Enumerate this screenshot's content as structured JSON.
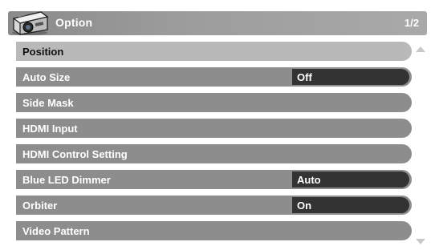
{
  "header": {
    "icon": "projector-icon",
    "title": "Option",
    "page_indicator": "1/2"
  },
  "menu": {
    "items": [
      {
        "label": "Position",
        "value": null,
        "selected": true
      },
      {
        "label": "Auto Size",
        "value": "Off"
      },
      {
        "label": "Side Mask",
        "value": null
      },
      {
        "label": "HDMI Input",
        "value": null
      },
      {
        "label": "HDMI Control Setting",
        "value": null
      },
      {
        "label": "Blue LED Dimmer",
        "value": "Auto"
      },
      {
        "label": "Orbiter",
        "value": "On"
      },
      {
        "label": "Video Pattern",
        "value": null
      }
    ]
  },
  "scroll": {
    "up_icon": "scroll-up-arrow-icon",
    "down_icon": "scroll-down-arrow-icon"
  },
  "colors": {
    "header_bg": "#9c9c9c",
    "row_bg": "#8d8d8d",
    "selected_row_bg": "#b9b9b9",
    "value_bg": "#333333",
    "text": "#ffffff"
  }
}
